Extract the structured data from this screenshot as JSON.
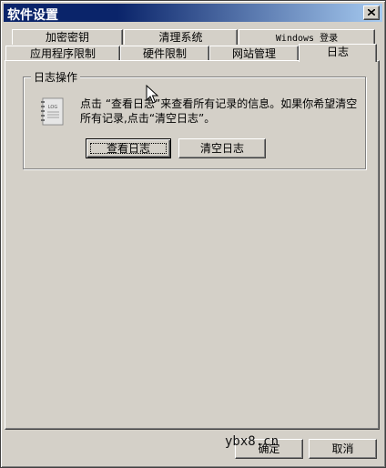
{
  "window": {
    "title": "软件设置",
    "close_symbol": "close"
  },
  "tabs_row1": [
    {
      "label": "加密密钥"
    },
    {
      "label": "清理系统"
    },
    {
      "label": "Windows 登录"
    }
  ],
  "tabs_row2": [
    {
      "label": "应用程序限制"
    },
    {
      "label": "硬件限制"
    },
    {
      "label": "网站管理"
    },
    {
      "label": "日志",
      "active": true
    }
  ],
  "group": {
    "title": "日志操作",
    "icon": "log-file-icon",
    "icon_text": "LOG",
    "description": "点击 “查看日志”来查看所有记录的信息。如果你希望清空所有记录,点击“清空日志”。",
    "view_button": "查看日志",
    "clear_button": "清空日志"
  },
  "footer": {
    "ok_button": "确定",
    "cancel_button": "取消"
  },
  "watermark": "ybx8.cn"
}
